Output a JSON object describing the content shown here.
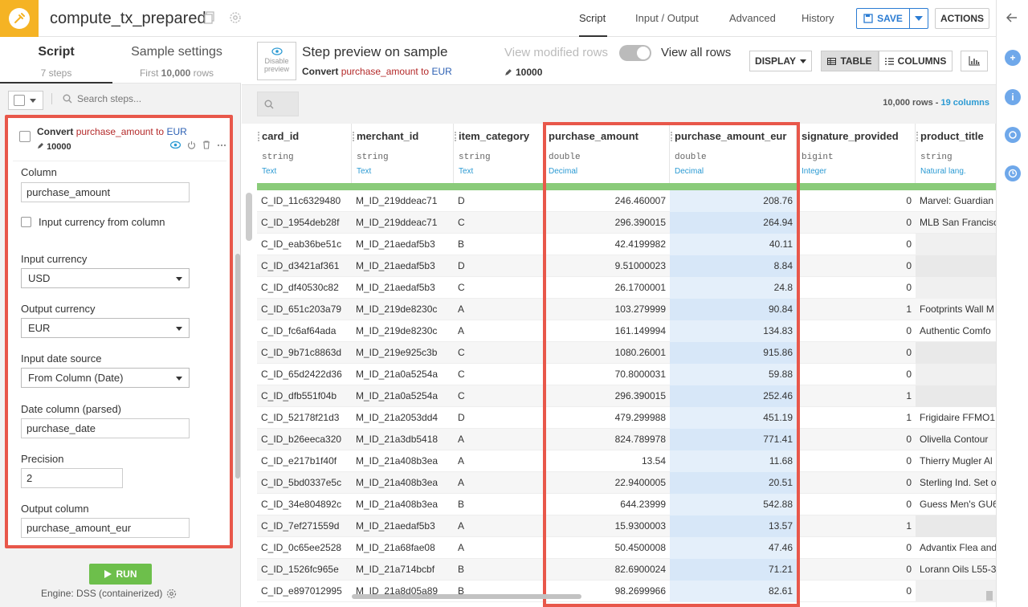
{
  "app": {
    "recipe_name": "compute_tx_prepared"
  },
  "nav": {
    "tabs": [
      "Script",
      "Input / Output",
      "Advanced",
      "History"
    ],
    "active": "Script",
    "save_label": "SAVE",
    "actions_label": "ACTIONS"
  },
  "colors": {
    "accent": "#f5b324",
    "highlight": "#e8574a",
    "run": "#6dbf4b",
    "link": "#2b9ad3"
  },
  "left_panel": {
    "tab_script": "Script",
    "tab_script_sub": "7 steps",
    "tab_sample": "Sample settings",
    "tab_sample_sub_prefix": "First ",
    "tab_sample_sub_bold": "10,000",
    "tab_sample_sub_suffix": " rows",
    "search_placeholder": "Search steps...",
    "step": {
      "title_prefix": "Convert ",
      "title_col": "purchase_amount",
      "title_mid": " to ",
      "title_cur": "EUR",
      "count": "10000",
      "fields": {
        "column_label": "Column",
        "column_value": "purchase_amount",
        "currency_from_column_label": "Input currency from column",
        "input_currency_label": "Input currency",
        "input_currency_value": "USD",
        "output_currency_label": "Output currency",
        "output_currency_value": "EUR",
        "date_source_label": "Input date source",
        "date_source_value": "From Column (Date)",
        "date_column_label": "Date column (parsed)",
        "date_column_value": "purchase_date",
        "precision_label": "Precision",
        "precision_value": "2",
        "output_column_label": "Output column",
        "output_column_value": "purchase_amount_eur"
      }
    },
    "run_label": "RUN",
    "engine_label": "Engine: DSS (containerized)"
  },
  "preview": {
    "disable_label_1": "Disable",
    "disable_label_2": "preview",
    "title": "Step preview on sample",
    "sub_prefix": "Convert ",
    "sub_col": "purchase_amount",
    "sub_mid": " to ",
    "sub_cur": "EUR",
    "view_modified": "View modified rows",
    "view_all": "View all rows",
    "row_count": "10000",
    "display_label": "DISPLAY",
    "table_label": "TABLE",
    "columns_label": "COLUMNS",
    "rows_label_num": "10,000",
    "rows_label_word": " rows - ",
    "cols_label": "19 columns"
  },
  "table": {
    "columns": [
      {
        "name": "card_id",
        "type": "string",
        "meaning": "Text"
      },
      {
        "name": "merchant_id",
        "type": "string",
        "meaning": "Text"
      },
      {
        "name": "item_category",
        "type": "string",
        "meaning": "Text"
      },
      {
        "name": "purchase_amount",
        "type": "double",
        "meaning": "Decimal"
      },
      {
        "name": "purchase_amount_eur",
        "type": "double",
        "meaning": "Decimal"
      },
      {
        "name": "signature_provided",
        "type": "bigint",
        "meaning": "Integer"
      },
      {
        "name": "product_title",
        "type": "string",
        "meaning": "Natural lang."
      }
    ],
    "rows": [
      [
        "C_ID_11c6329480",
        "M_ID_219ddeac71",
        "D",
        "246.460007",
        "208.76",
        "0",
        "Marvel: Guardian"
      ],
      [
        "C_ID_1954deb28f",
        "M_ID_219ddeac71",
        "C",
        "296.390015",
        "264.94",
        "0",
        "MLB San Francisc"
      ],
      [
        "C_ID_eab36be51c",
        "M_ID_21aedaf5b3",
        "B",
        "42.4199982",
        "40.11",
        "0",
        ""
      ],
      [
        "C_ID_d3421af361",
        "M_ID_21aedaf5b3",
        "D",
        "9.51000023",
        "8.84",
        "0",
        ""
      ],
      [
        "C_ID_df40530c82",
        "M_ID_21aedaf5b3",
        "C",
        "26.1700001",
        "24.8",
        "0",
        ""
      ],
      [
        "C_ID_651c203a79",
        "M_ID_219de8230c",
        "A",
        "103.279999",
        "90.84",
        "1",
        "Footprints Wall M"
      ],
      [
        "C_ID_fc6af64ada",
        "M_ID_219de8230c",
        "A",
        "161.149994",
        "134.83",
        "0",
        "Authentic Comfo"
      ],
      [
        "C_ID_9b71c8863d",
        "M_ID_219e925c3b",
        "C",
        "1080.26001",
        "915.86",
        "0",
        ""
      ],
      [
        "C_ID_65d2422d36",
        "M_ID_21a0a5254a",
        "C",
        "70.8000031",
        "59.88",
        "0",
        ""
      ],
      [
        "C_ID_dfb551f04b",
        "M_ID_21a0a5254a",
        "C",
        "296.390015",
        "252.46",
        "1",
        ""
      ],
      [
        "C_ID_52178f21d3",
        "M_ID_21a2053dd4",
        "D",
        "479.299988",
        "451.19",
        "1",
        "Frigidaire FFMO1"
      ],
      [
        "C_ID_b26eeca320",
        "M_ID_21a3db5418",
        "A",
        "824.789978",
        "771.41",
        "0",
        "Olivella Contour"
      ],
      [
        "C_ID_e217b1f40f",
        "M_ID_21a408b3ea",
        "A",
        "13.54",
        "11.68",
        "0",
        "Thierry Mugler Al"
      ],
      [
        "C_ID_5bd0337e5c",
        "M_ID_21a408b3ea",
        "A",
        "22.9400005",
        "20.51",
        "0",
        "Sterling Ind. Set o"
      ],
      [
        "C_ID_34e804892c",
        "M_ID_21a408b3ea",
        "B",
        "644.23999",
        "542.88",
        "0",
        "Guess Men's GU6"
      ],
      [
        "C_ID_7ef271559d",
        "M_ID_21aedaf5b3",
        "A",
        "15.9300003",
        "13.57",
        "1",
        ""
      ],
      [
        "C_ID_0c65ee2528",
        "M_ID_21a68fae08",
        "A",
        "50.4500008",
        "47.46",
        "0",
        "Advantix Flea and"
      ],
      [
        "C_ID_1526fc965e",
        "M_ID_21a714bcbf",
        "B",
        "82.6900024",
        "71.21",
        "0",
        "Lorann Oils L55-3"
      ],
      [
        "C_ID_e897012995",
        "M_ID_21a8d05a89",
        "B",
        "98.2699966",
        "82.61",
        "0",
        ""
      ]
    ]
  }
}
